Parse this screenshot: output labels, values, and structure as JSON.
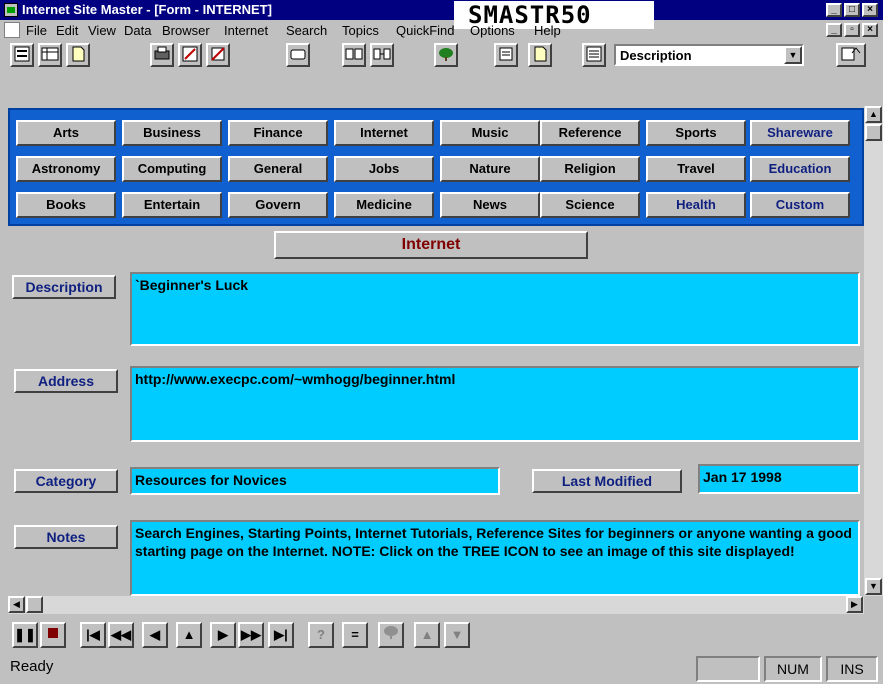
{
  "window": {
    "title": "Internet Site Master - [Form - INTERNET]",
    "form_code": "SMASTR50",
    "controls": [
      "_",
      "□",
      "×"
    ]
  },
  "menubar": {
    "items": [
      "File",
      "Edit",
      "View",
      "Data",
      "Browser",
      "Internet",
      "Search",
      "Topics",
      "QuickFind",
      "Options",
      "Help"
    ],
    "doc_controls": [
      "_",
      "▫",
      "×"
    ]
  },
  "toolbar": {
    "field_select": {
      "value": "Description"
    }
  },
  "categories": {
    "rows": [
      [
        "Arts",
        "Business",
        "Finance",
        "Internet",
        "Music",
        "Reference",
        "Sports",
        "Shareware"
      ],
      [
        "Astronomy",
        "Computing",
        "General",
        "Jobs",
        "Nature",
        "Religion",
        "Travel",
        "Education"
      ],
      [
        "Books",
        "Entertain",
        "Govern",
        "Medicine",
        "News",
        "Science",
        "Health",
        "Custom"
      ]
    ],
    "highlight_color": "#102080"
  },
  "form": {
    "title": "Internet",
    "description": {
      "label": "Description",
      "value": "`Beginner's Luck"
    },
    "address": {
      "label": "Address",
      "value": "http://www.execpc.com/~wmhogg/beginner.html"
    },
    "category": {
      "label": "Category",
      "value": "Resources for Novices"
    },
    "last_modified": {
      "label": "Last Modified",
      "value": "Jan 17 1998"
    },
    "notes": {
      "label": "Notes",
      "value": "Search Engines, Starting Points, Internet Tutorials, Reference Sites for beginners or anyone wanting a good starting page on the Internet.  NOTE: Click on the TREE ICON to see an image of this site displayed!"
    }
  },
  "status": {
    "text": "Ready",
    "num": "NUM",
    "ins": "INS"
  },
  "colors": {
    "title_bar": "#000080",
    "panel": "#1060d0",
    "field": "#00ccff",
    "form_title": "#800000"
  }
}
